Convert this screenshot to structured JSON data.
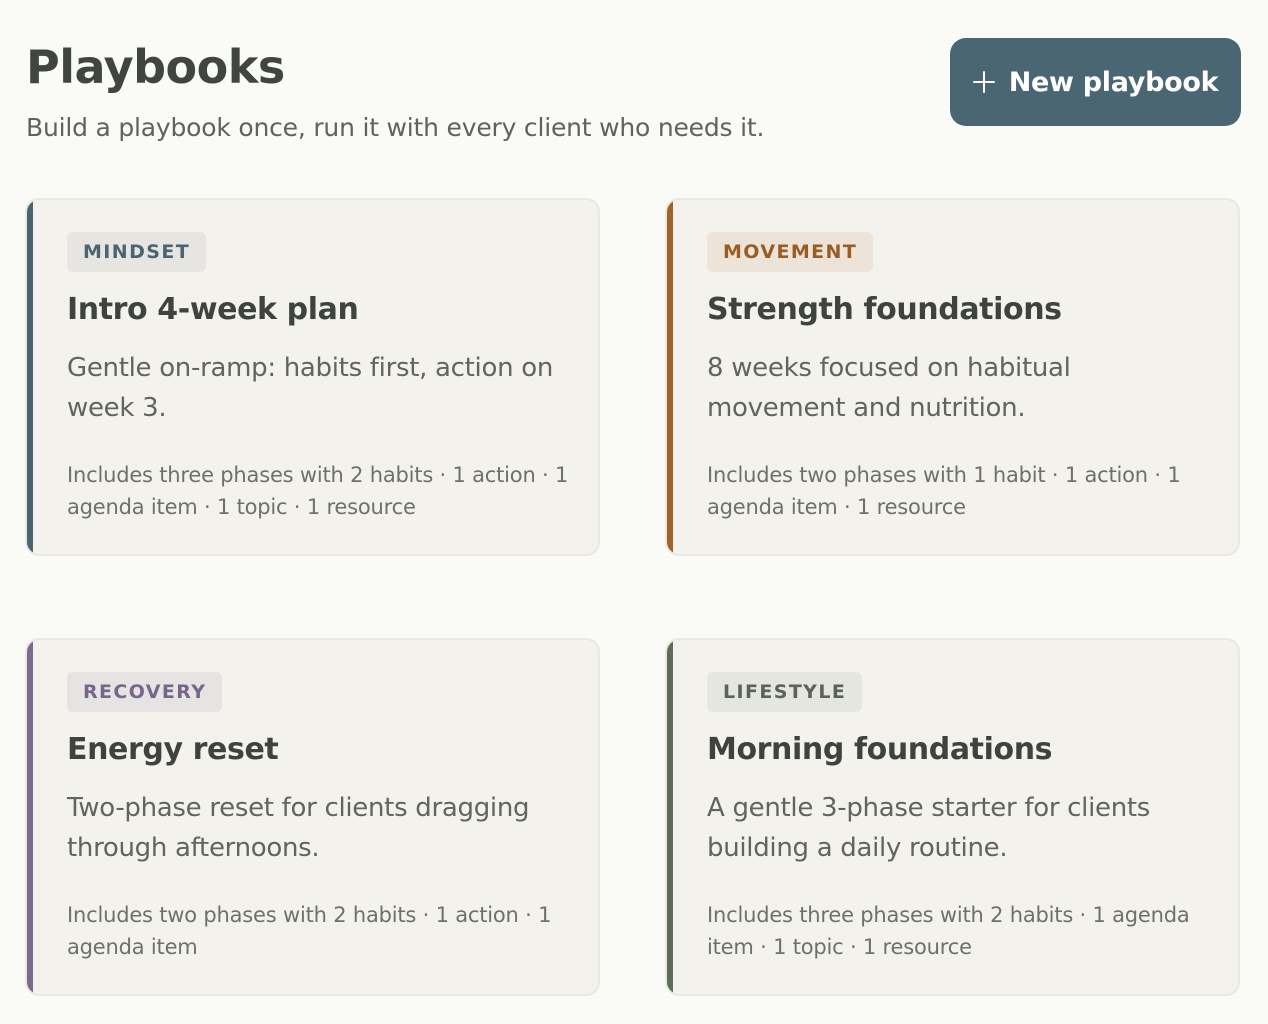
{
  "header": {
    "title": "Playbooks",
    "subtitle": "Build a playbook once, run it with every client who needs it.",
    "new_button_label": "New playbook"
  },
  "playbooks": [
    {
      "tag": "MINDSET",
      "title": "Intro 4-week plan",
      "description": "Gentle on-ramp: habits first, action on week 3.",
      "meta": "Includes three phases with 2 habits · 1 action · 1 agenda item · 1 topic · 1 resource",
      "accent_color": "#4b6570",
      "tag_bg": "#e6e5e1",
      "tag_color": "#4b6570"
    },
    {
      "tag": "MOVEMENT",
      "title": "Strength foundations",
      "description": "8 weeks focused on habitual movement and nutrition.",
      "meta": "Includes two phases with 1 habit · 1 action · 1 agenda item · 1 resource",
      "accent_color": "#a0622a",
      "tag_bg": "#ece4d8",
      "tag_color": "#9a5b25"
    },
    {
      "tag": "RECOVERY",
      "title": "Energy reset",
      "description": "Two-phase reset for clients dragging through afternoons.",
      "meta": "Includes two phases with 2 habits · 1 action · 1 agenda item",
      "accent_color": "#7c6a8e",
      "tag_bg": "#e6e4e3",
      "tag_color": "#76668a"
    },
    {
      "tag": "LIFESTYLE",
      "title": "Morning foundations",
      "description": "A gentle 3-phase starter for clients building a daily routine.",
      "meta": "Includes three phases with 2 habits · 1 agenda item · 1 topic · 1 resource",
      "accent_color": "#5e6b5c",
      "tag_bg": "#e6e6e1",
      "tag_color": "#5a6359"
    }
  ]
}
